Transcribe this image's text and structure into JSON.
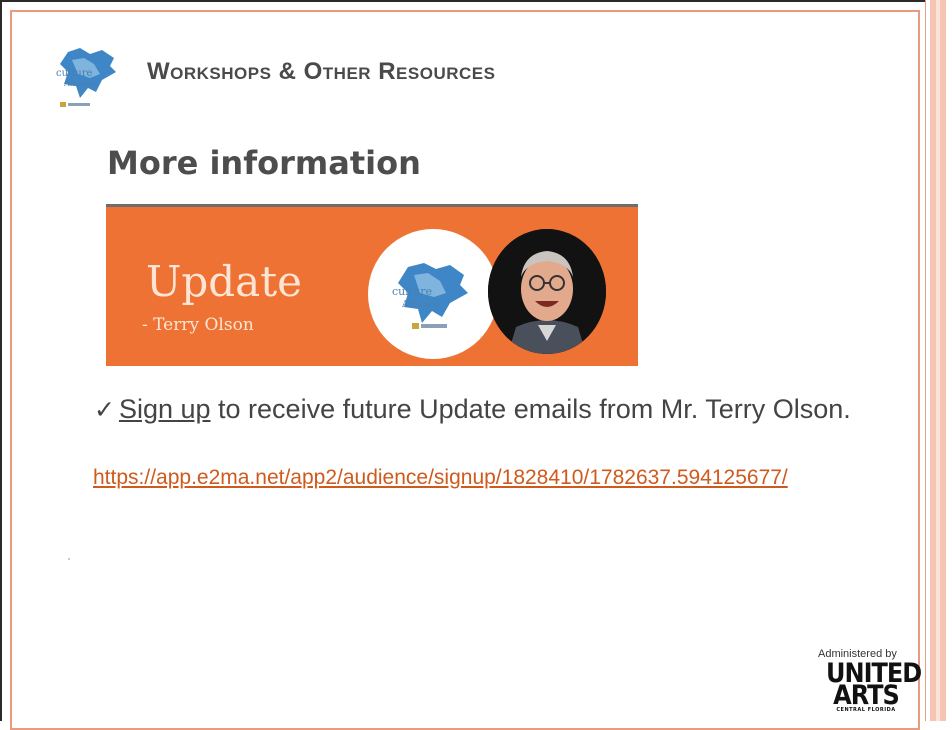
{
  "slide": {
    "title": "Workshops & Other Resources",
    "subtitle": "More information",
    "logo_icon": "florida-map-icon"
  },
  "banner": {
    "title": "Update",
    "subtitle": "- Terry Olson",
    "colors": {
      "background": "#ee7233",
      "text": "#fde5d6"
    }
  },
  "bullets": [
    {
      "check_icon": "checkmark-icon",
      "link_text": "Sign up",
      "text": " to receive future Update emails from Mr. Terry Olson.",
      "url": "https://app.e2ma.net/app2/audience/signup/1828410/1782637.594125677/"
    }
  ],
  "footer": {
    "administered_by": "Administered by",
    "org_line1": "UNITED",
    "org_line2": "ARTS",
    "org_line3": "CENTRAL FLORIDA"
  },
  "colors": {
    "accent": "#ee7233",
    "border": "#e99b7f",
    "link": "#d05a1c",
    "text": "#444444"
  }
}
